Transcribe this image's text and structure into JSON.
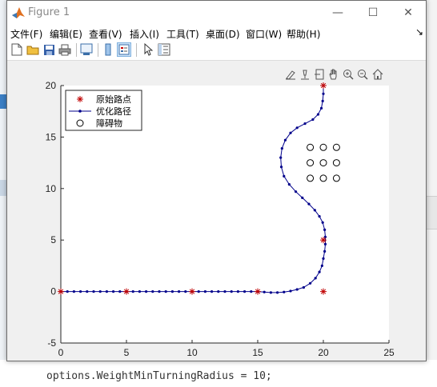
{
  "window": {
    "title": "Figure 1",
    "controls": {
      "minimize": "—",
      "maximize": "☐",
      "close": "✕"
    }
  },
  "menu": {
    "items": [
      "文件(F)",
      "编辑(E)",
      "查看(V)",
      "插入(I)",
      "工具(T)",
      "桌面(D)",
      "窗口(W)",
      "帮助(H)"
    ],
    "dock_arrow": "↘"
  },
  "toolbar": {
    "icons": [
      "new-figure-icon",
      "open-file-icon",
      "save-icon",
      "print-icon",
      "link-plot-icon",
      "colorbar-icon",
      "legend-icon",
      "pointer-icon",
      "property-inspector-icon"
    ]
  },
  "axes_toolbar": {
    "icons": [
      "brush-icon",
      "data-tips-icon",
      "export-icon",
      "pan-icon",
      "zoom-in-icon",
      "zoom-out-icon",
      "home-icon"
    ]
  },
  "background": {
    "command_text": "options.WeightMinTurningRadius = 10;"
  },
  "chart_data": {
    "type": "scatter",
    "xlim": [
      0,
      25
    ],
    "ylim": [
      -5,
      20
    ],
    "xticks": [
      0,
      5,
      10,
      15,
      20,
      25
    ],
    "yticks": [
      -5,
      0,
      5,
      10,
      15,
      20
    ],
    "xlabel": "",
    "ylabel": "",
    "title": "",
    "grid": false,
    "legend_position": "top-left",
    "series": [
      {
        "name": "原始路点",
        "marker": "star",
        "color": "#c00000",
        "points": [
          [
            0,
            0
          ],
          [
            5,
            0
          ],
          [
            10,
            0
          ],
          [
            15,
            0
          ],
          [
            20,
            0
          ],
          [
            20,
            5
          ],
          [
            20,
            20
          ]
        ]
      },
      {
        "name": "优化路径",
        "marker": "dot-line",
        "color": "#00008b",
        "points": [
          [
            0,
            0
          ],
          [
            0.5,
            0
          ],
          [
            1,
            0
          ],
          [
            1.5,
            0
          ],
          [
            2,
            0
          ],
          [
            2.5,
            0
          ],
          [
            3,
            0
          ],
          [
            3.5,
            0
          ],
          [
            4,
            0
          ],
          [
            4.5,
            0
          ],
          [
            5,
            0
          ],
          [
            5.5,
            0
          ],
          [
            6,
            0
          ],
          [
            6.5,
            0
          ],
          [
            7,
            0
          ],
          [
            7.5,
            0
          ],
          [
            8,
            0
          ],
          [
            8.5,
            0
          ],
          [
            9,
            0
          ],
          [
            9.5,
            0
          ],
          [
            10,
            0
          ],
          [
            10.5,
            0
          ],
          [
            11,
            0
          ],
          [
            11.5,
            0
          ],
          [
            12,
            0
          ],
          [
            12.5,
            0
          ],
          [
            13,
            0
          ],
          [
            13.5,
            0
          ],
          [
            14,
            0
          ],
          [
            14.5,
            0
          ],
          [
            15,
            0
          ],
          [
            15.5,
            -0.05
          ],
          [
            16,
            -0.1
          ],
          [
            16.5,
            -0.1
          ],
          [
            17,
            -0.05
          ],
          [
            17.5,
            0.05
          ],
          [
            18,
            0.2
          ],
          [
            18.5,
            0.4
          ],
          [
            19,
            0.8
          ],
          [
            19.4,
            1.3
          ],
          [
            19.7,
            1.9
          ],
          [
            19.9,
            2.5
          ],
          [
            20,
            3.2
          ],
          [
            20.1,
            3.9
          ],
          [
            20.15,
            4.6
          ],
          [
            20.15,
            5.3
          ],
          [
            20.1,
            6.0
          ],
          [
            19.95,
            6.7
          ],
          [
            19.7,
            7.3
          ],
          [
            19.35,
            7.9
          ],
          [
            18.9,
            8.5
          ],
          [
            18.4,
            9.1
          ],
          [
            17.9,
            9.7
          ],
          [
            17.4,
            10.4
          ],
          [
            17,
            11.2
          ],
          [
            16.8,
            12.1
          ],
          [
            16.75,
            13.0
          ],
          [
            16.85,
            13.9
          ],
          [
            17.1,
            14.7
          ],
          [
            17.5,
            15.4
          ],
          [
            18,
            15.9
          ],
          [
            18.6,
            16.3
          ],
          [
            19.2,
            16.7
          ],
          [
            19.6,
            17.2
          ],
          [
            19.85,
            17.8
          ],
          [
            19.95,
            18.5
          ],
          [
            20,
            19.2
          ],
          [
            20,
            20
          ]
        ]
      },
      {
        "name": "障碍物",
        "marker": "circle",
        "color": "#000000",
        "points": [
          [
            19,
            14
          ],
          [
            20,
            14
          ],
          [
            21,
            14
          ],
          [
            19,
            12.5
          ],
          [
            20,
            12.5
          ],
          [
            21,
            12.5
          ],
          [
            19,
            11
          ],
          [
            20,
            11
          ],
          [
            21,
            11
          ]
        ]
      }
    ]
  }
}
